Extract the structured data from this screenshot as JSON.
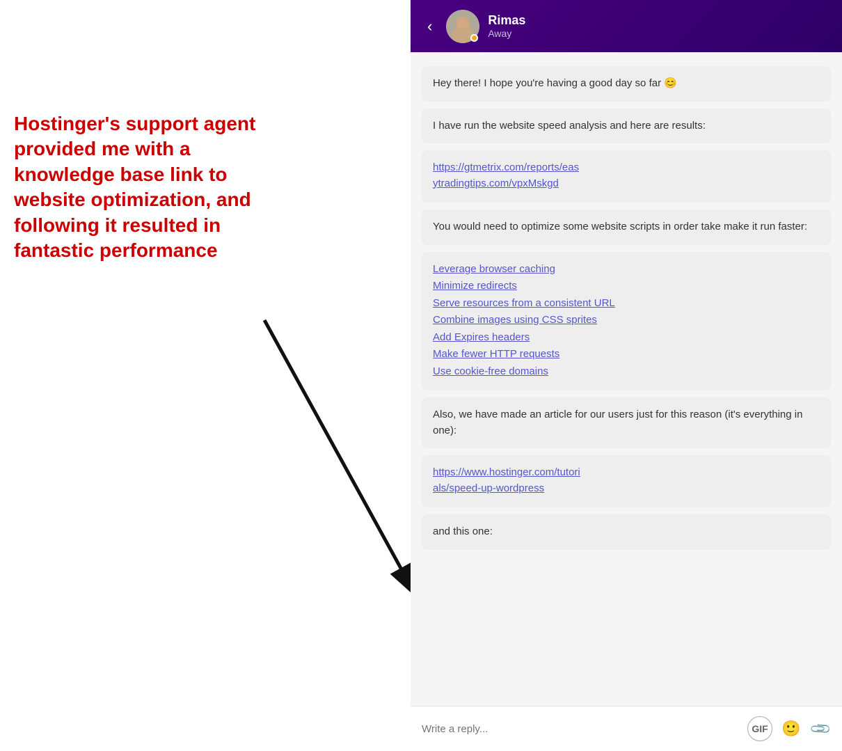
{
  "annotation": {
    "text": "Hostinger's support agent provided me with a knowledge base link to website optimization, and following it resulted in fantastic performance"
  },
  "header": {
    "back_label": "‹",
    "agent_name": "Rimas",
    "agent_status": "Away"
  },
  "messages": [
    {
      "id": "msg1",
      "type": "greeting",
      "text": "Hey there! I hope you're having a good day so far 😊"
    },
    {
      "id": "msg2",
      "type": "info",
      "text": "I have run the website speed analysis and here are results:"
    },
    {
      "id": "msg3",
      "type": "link",
      "url": "https://gtmetrix.com/reports/easytradingtips.com/vpxMskgd",
      "display": "https://gtmetrix.com/reports/easytradingtips.com/vpxMskgd"
    },
    {
      "id": "msg4",
      "type": "info",
      "text": "You would need to optimize some website scripts in order take make it run faster:"
    },
    {
      "id": "msg5",
      "type": "links_list",
      "links": [
        "Leverage browser caching",
        "Minimize redirects",
        "Serve resources from a consistent URL",
        "Combine images using CSS sprites",
        "Add Expires headers",
        "Make fewer HTTP requests",
        "Use cookie-free domains"
      ]
    },
    {
      "id": "msg6",
      "type": "info",
      "text": "Also, we have made an article for our users just for this reason (it's everything in one):"
    },
    {
      "id": "msg7",
      "type": "link",
      "url": "https://www.hostinger.com/tutorials/speed-up-wordpress",
      "display": "https://www.hostinger.com/tutorials/speed-up-wordpress"
    },
    {
      "id": "msg8",
      "type": "partial",
      "text": "and this one:"
    }
  ],
  "input": {
    "placeholder": "Write a reply...",
    "gif_label": "GIF"
  }
}
